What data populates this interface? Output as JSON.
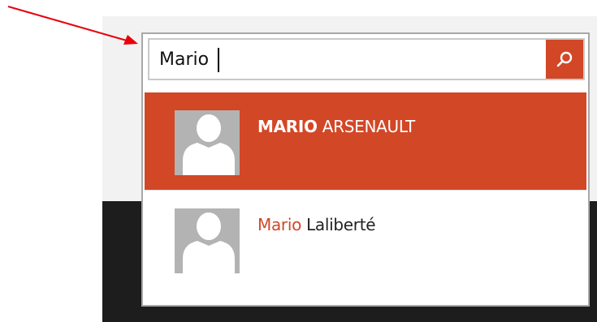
{
  "search": {
    "value": "Mario",
    "placeholder": ""
  },
  "results": [
    {
      "match": "MARIO",
      "rest": " ARSENAULT",
      "selected": true
    },
    {
      "match": "Mario",
      "rest": " Laliberté",
      "selected": false
    }
  ],
  "colors": {
    "accent": "#d24726",
    "annotation_arrow": "#e8000b",
    "avatar_bg": "#b3b3b3",
    "dark_background": "#1d1d1d"
  },
  "icons": {
    "search_button": "search-icon",
    "avatar": "person-icon",
    "annotation": "arrow-icon"
  }
}
